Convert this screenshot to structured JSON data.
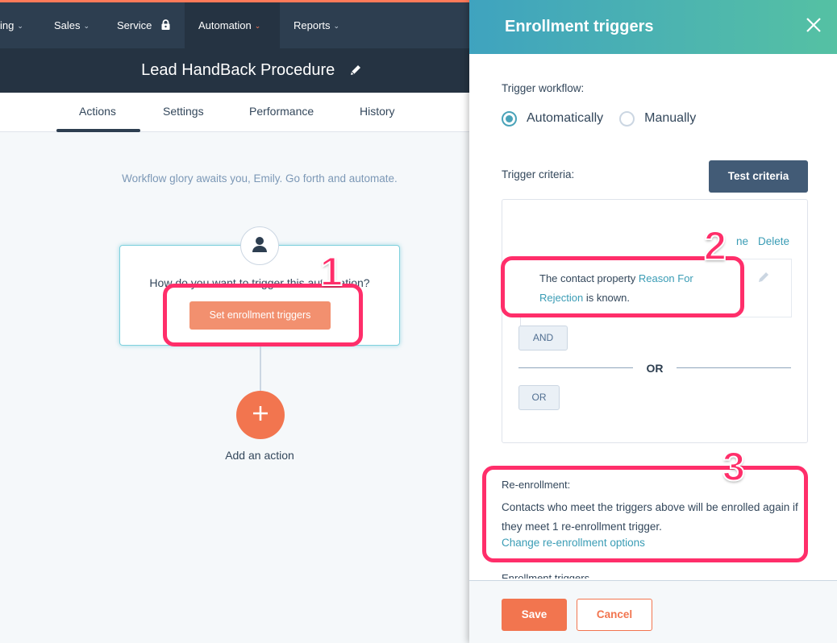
{
  "topnav": {
    "items": [
      {
        "label": "ing",
        "chevron": true
      },
      {
        "label": "Sales",
        "chevron": true
      },
      {
        "label": "Service",
        "icon": "lock-icon"
      },
      {
        "label": "Automation",
        "chevron": true,
        "active": true
      },
      {
        "label": "Reports",
        "chevron": true
      }
    ]
  },
  "workflow": {
    "title": "Lead HandBack Procedure",
    "tabs": [
      {
        "label": "Actions",
        "active": true
      },
      {
        "label": "Settings"
      },
      {
        "label": "Performance"
      },
      {
        "label": "History"
      }
    ],
    "greeting": "Workflow glory awaits you, Emily. Go forth and automate.",
    "trigger_question": "How do you want to trigger this automation?",
    "set_triggers_label": "Set enrollment triggers",
    "add_action_label": "Add an action"
  },
  "panel": {
    "title": "Enrollment triggers",
    "trigger_workflow_label": "Trigger workflow:",
    "radio_options": [
      {
        "label": "Automatically",
        "selected": true
      },
      {
        "label": "Manually",
        "selected": false
      }
    ],
    "trigger_criteria_label": "Trigger criteria:",
    "test_criteria_label": "Test criteria",
    "criteria_actions": {
      "clone_partial": "ne",
      "delete": "Delete"
    },
    "filter": {
      "prefix": "The contact property ",
      "property": "Reason For Rejection",
      "suffix": " is known."
    },
    "and_label": "AND",
    "or_divider": "OR",
    "or_label": "OR",
    "reenrollment": {
      "title": "Re-enrollment:",
      "text": "Contacts who meet the triggers above will be enrolled again if they meet 1 re-enrollment trigger.",
      "link": "Change re-enrollment options"
    },
    "cut_label": "Enrollment triggers",
    "save_label": "Save",
    "cancel_label": "Cancel"
  },
  "annotations": [
    "1",
    "2",
    "3"
  ],
  "colors": {
    "accent_orange": "#f2754f",
    "link_teal": "#3a9cb5",
    "nav_dark": "#2d3e50",
    "highlight_pink": "#ff2e6a"
  }
}
